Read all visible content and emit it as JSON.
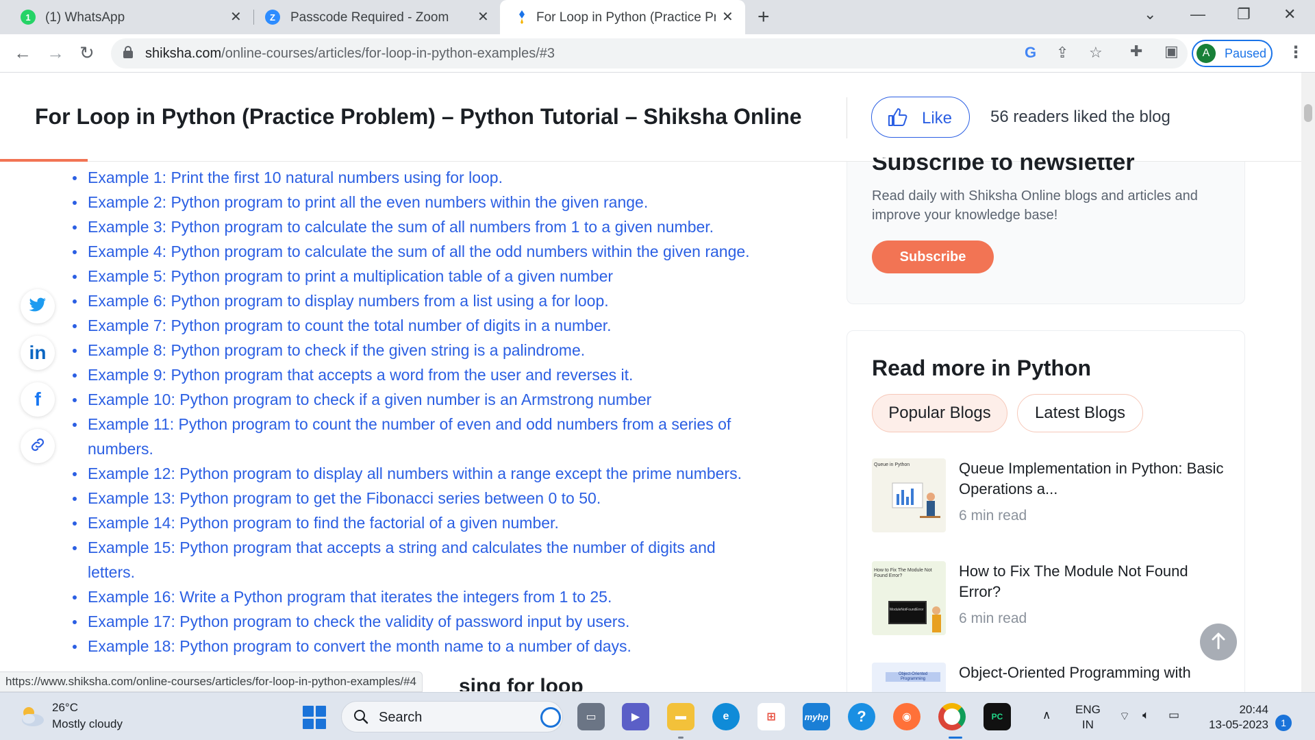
{
  "browser": {
    "tabs": [
      {
        "label": "(1) WhatsApp",
        "badge": "1",
        "color": "#25d366"
      },
      {
        "label": "Passcode Required - Zoom",
        "badge": "Z",
        "color": "#2d8cff"
      },
      {
        "label": "For Loop in Python (Practice Prob",
        "badge": "",
        "color": "#1a73e8"
      }
    ],
    "url_domain": "shiksha.com",
    "url_path": "/online-courses/articles/for-loop-in-python-examples/#3",
    "profile_initial": "A",
    "profile_status": "Paused"
  },
  "article": {
    "title": "For Loop in Python (Practice Problem) – Python Tutorial – Shiksha Online",
    "like_label": "Like",
    "readers_text": "56 readers liked the blog",
    "examples": [
      {
        "label": "Example 1: Print the first 10 natural numbers using for loop.",
        "line2": ""
      },
      {
        "label": "Example 2: Python program to print all the even numbers within the given range.",
        "line2": ""
      },
      {
        "label": "Example 3: Python program to calculate the sum of all numbers from 1 to a given number.",
        "line2": ""
      },
      {
        "label": "Example 4: Python program to calculate the sum of all the odd numbers within the given range.",
        "line2": ""
      },
      {
        "label": "Example 5: Python program to print a multiplication table of a given number",
        "line2": ""
      },
      {
        "label": "Example 6: Python program to display numbers from a list using a for loop.",
        "line2": ""
      },
      {
        "label": "Example 7: Python program to count the total number of digits in a number.",
        "line2": ""
      },
      {
        "label": "Example 8: Python program to check if the given string is a palindrome.",
        "line2": ""
      },
      {
        "label": "Example 9: Python program that accepts a word from the user and reverses it.",
        "line2": ""
      },
      {
        "label": "Example 10: Python program to check if a given number is an Armstrong number",
        "line2": ""
      },
      {
        "label": "Example 11: Python program to count the number of even and odd numbers from a series of",
        "line2": "numbers."
      },
      {
        "label": "Example 12: Python program to display all numbers within a range except the prime numbers.",
        "line2": ""
      },
      {
        "label": "Example 13: Python program to get the Fibonacci series between 0 to 50.",
        "line2": ""
      },
      {
        "label": "Example 14: Python program to find the factorial of a given number.",
        "line2": ""
      },
      {
        "label": "Example 15: Python program that accepts a string and calculates the number of digits and",
        "line2": "letters."
      },
      {
        "label": "Example 16: Write a Python program that iterates the integers from 1 to 25.",
        "line2": ""
      },
      {
        "label": "Example 17: Python program to check the validity of password input by users.",
        "line2": ""
      },
      {
        "label": "Example 18: Python program to convert the month name to a number of days.",
        "line2": ""
      }
    ],
    "partial_heading": "sing for loop"
  },
  "social": [
    "twitter-icon",
    "linkedin-icon",
    "facebook-icon",
    "link-icon"
  ],
  "sidebar": {
    "subscribe_heading": "Subscribe to newsletter",
    "subscribe_desc": "Read daily with Shiksha Online blogs and articles and improve your knowledge base!",
    "subscribe_button": "Subscribe",
    "readmore_heading": "Read more in Python",
    "tabs": [
      "Popular Blogs",
      "Latest Blogs"
    ],
    "blogs": [
      {
        "title": "Queue Implementation in Python: Basic Operations a...",
        "meta": "6 min read",
        "thumb_text": "Queue in Python"
      },
      {
        "title": "How to Fix The Module Not Found Error?",
        "meta": "6 min read",
        "thumb_text": "How to Fix The Module Not Found Error?",
        "thumb_code": "ModuleNotFoundError"
      },
      {
        "title": "Object-Oriented Programming with",
        "meta": "",
        "thumb_text": "Object-Oriented Programming"
      }
    ]
  },
  "status_url": "https://www.shiksha.com/online-courses/articles/for-loop-in-python-examples/#4",
  "taskbar": {
    "temp": "26°C",
    "weather": "Mostly cloudy",
    "search_label": "Search",
    "lang1": "ENG",
    "lang2": "IN",
    "time": "20:44",
    "date": "13-05-2023",
    "notifications": "1"
  },
  "colors": {
    "link": "#2b5fe3",
    "accent": "#f27454"
  }
}
